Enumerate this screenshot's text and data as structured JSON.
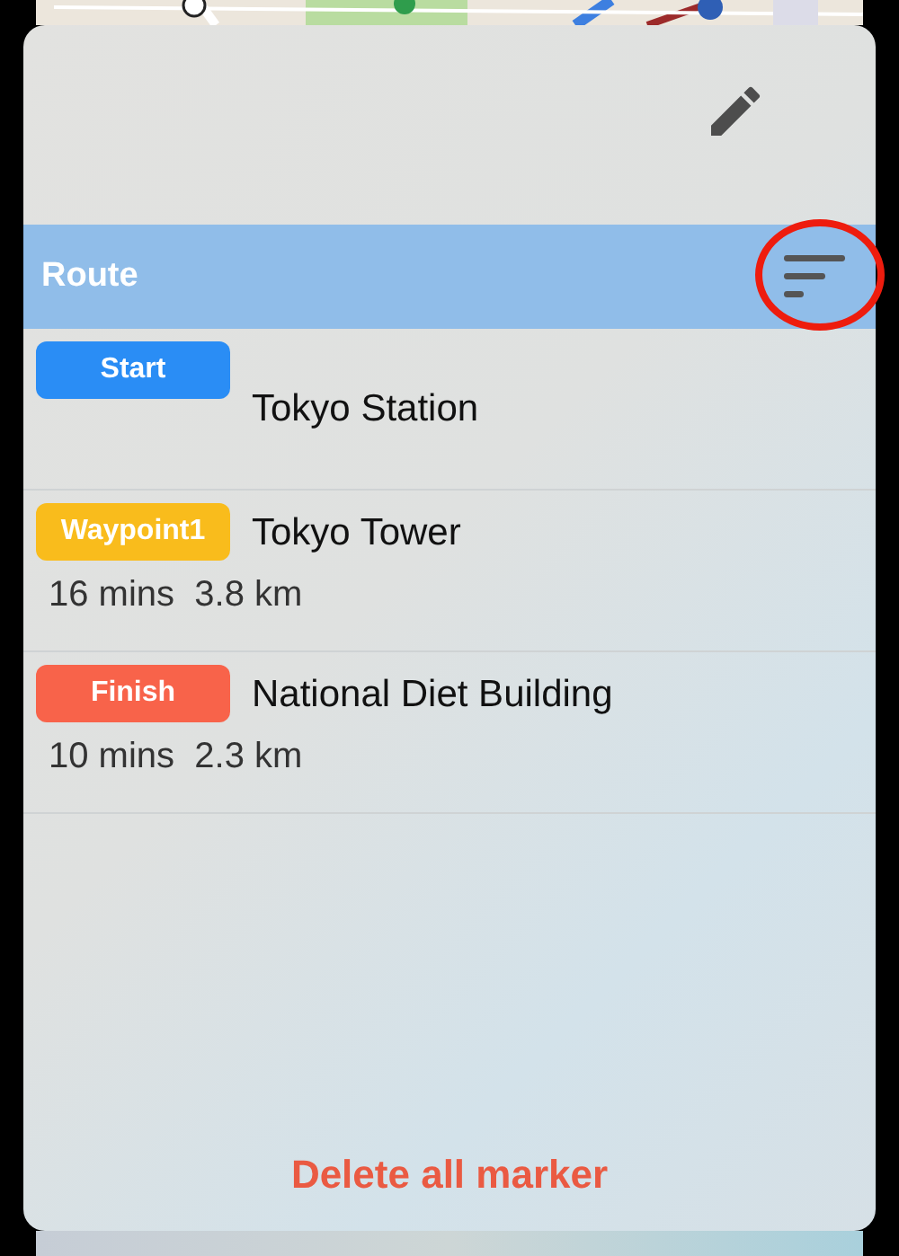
{
  "header": {
    "title": "Route"
  },
  "stops": [
    {
      "badge": "Start",
      "color": "#2a8df5",
      "name": "Tokyo Station"
    },
    {
      "badge": "Waypoint1",
      "color": "#f9bc1c",
      "name": "Tokyo Tower",
      "info": "16 mins  3.8 km"
    },
    {
      "badge": "Finish",
      "color": "#f8634a",
      "name": "National Diet Building",
      "info": "10 mins  2.3 km"
    }
  ],
  "delete_button": "Delete all marker"
}
